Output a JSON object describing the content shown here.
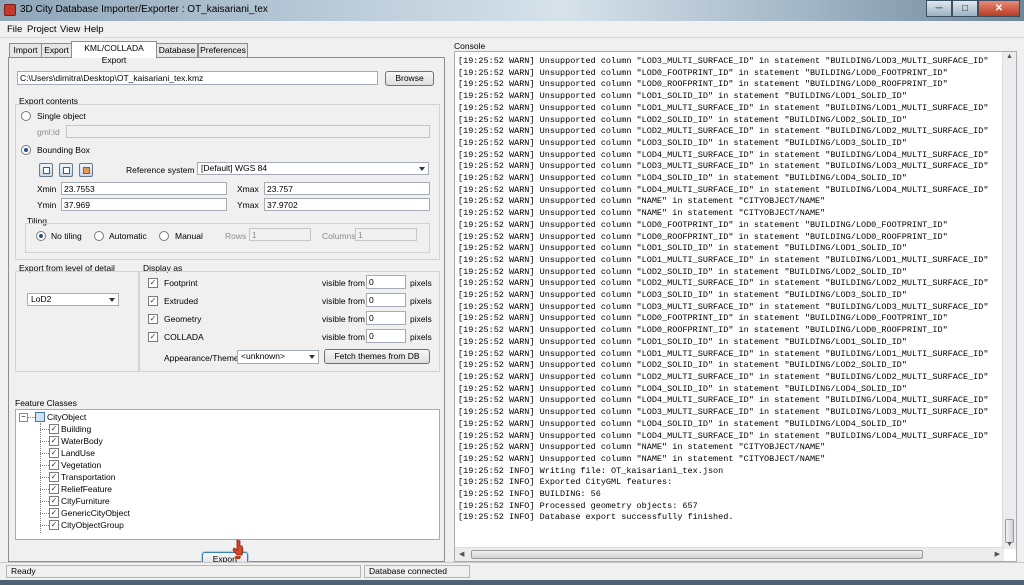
{
  "window": {
    "title": "3D City Database Importer/Exporter : OT_kaisariani_tex"
  },
  "window_controls": {
    "minimize": "─",
    "maximize": "□",
    "close": "✕"
  },
  "menu": {
    "file": "File",
    "project": "Project",
    "view": "View",
    "help": "Help"
  },
  "tabs": {
    "import": "Import",
    "export": "Export",
    "kml": "KML/COLLADA Export",
    "database": "Database",
    "preferences": "Preferences"
  },
  "file": {
    "path": "C:\\Users\\dimitra\\Desktop\\OT_kaisariani_tex.kmz",
    "browse": "Browse"
  },
  "export_contents": {
    "label": "Export contents",
    "single_object": "Single object",
    "gmlid_label": "gml:id",
    "bounding_box": "Bounding Box",
    "mode": "Bounding Box",
    "ref_system_label": "Reference system",
    "ref_system_value": "[Default] WGS 84",
    "xmin_label": "Xmin",
    "xmin": "23.7553",
    "xmax_label": "Xmax",
    "xmax": "23.757",
    "ymin_label": "Ymin",
    "ymin": "37.969",
    "ymax_label": "Ymax",
    "ymax": "37.9702"
  },
  "tiling": {
    "label": "Tiling",
    "no_tiling": "No tiling",
    "automatic": "Automatic",
    "manual": "Manual",
    "selected": "No tiling",
    "rows_label": "Rows",
    "rows": "1",
    "columns_label": "Columns",
    "columns": "1"
  },
  "lod": {
    "label": "Export from level of detail",
    "value": "LoD2"
  },
  "display_as": {
    "label": "Display as",
    "visible_from": "visible from",
    "pixels": "pixels",
    "rows": [
      {
        "name": "Footprint",
        "checked": true,
        "value": "0"
      },
      {
        "name": "Extruded",
        "checked": true,
        "value": "0"
      },
      {
        "name": "Geometry",
        "checked": true,
        "value": "0"
      },
      {
        "name": "COLLADA",
        "checked": true,
        "value": "0"
      }
    ],
    "appearance_label": "Appearance/Theme",
    "appearance_value": "<unknown>",
    "fetch_button": "Fetch themes from DB"
  },
  "feature_classes": {
    "label": "Feature Classes",
    "root": "CityObject",
    "items": [
      "Building",
      "WaterBody",
      "LandUse",
      "Vegetation",
      "Transportation",
      "ReliefFeature",
      "CityFurniture",
      "GenericCityObject",
      "CityObjectGroup"
    ]
  },
  "export_button": "Export",
  "console": {
    "label": "Console",
    "lines": [
      "[19:25:52 WARN] Unsupported column \"LOD3_MULTI_SURFACE_ID\" in statement \"BUILDING/LOD3_MULTI_SURFACE_ID\"",
      "[19:25:52 WARN] Unsupported column \"LOD0_FOOTPRINT_ID\" in statement \"BUILDING/LOD0_FOOTPRINT_ID\"",
      "[19:25:52 WARN] Unsupported column \"LOD0_ROOFPRINT_ID\" in statement \"BUILDING/LOD0_ROOFPRINT_ID\"",
      "[19:25:52 WARN] Unsupported column \"LOD1_SOLID_ID\" in statement \"BUILDING/LOD1_SOLID_ID\"",
      "[19:25:52 WARN] Unsupported column \"LOD1_MULTI_SURFACE_ID\" in statement \"BUILDING/LOD1_MULTI_SURFACE_ID\"",
      "[19:25:52 WARN] Unsupported column \"LOD2_SOLID_ID\" in statement \"BUILDING/LOD2_SOLID_ID\"",
      "[19:25:52 WARN] Unsupported column \"LOD2_MULTI_SURFACE_ID\" in statement \"BUILDING/LOD2_MULTI_SURFACE_ID\"",
      "[19:25:52 WARN] Unsupported column \"LOD3_SOLID_ID\" in statement \"BUILDING/LOD3_SOLID_ID\"",
      "[19:25:52 WARN] Unsupported column \"LOD4_MULTI_SURFACE_ID\" in statement \"BUILDING/LOD4_MULTI_SURFACE_ID\"",
      "[19:25:52 WARN] Unsupported column \"LOD3_MULTI_SURFACE_ID\" in statement \"BUILDING/LOD3_MULTI_SURFACE_ID\"",
      "[19:25:52 WARN] Unsupported column \"LOD4_SOLID_ID\" in statement \"BUILDING/LOD4_SOLID_ID\"",
      "[19:25:52 WARN] Unsupported column \"LOD4_MULTI_SURFACE_ID\" in statement \"BUILDING/LOD4_MULTI_SURFACE_ID\"",
      "[19:25:52 WARN] Unsupported column \"NAME\" in statement \"CITYOBJECT/NAME\"",
      "[19:25:52 WARN] Unsupported column \"NAME\" in statement \"CITYOBJECT/NAME\"",
      "[19:25:52 WARN] Unsupported column \"LOD0_FOOTPRINT_ID\" in statement \"BUILDING/LOD0_FOOTPRINT_ID\"",
      "[19:25:52 WARN] Unsupported column \"LOD0_ROOFPRINT_ID\" in statement \"BUILDING/LOD0_ROOFPRINT_ID\"",
      "[19:25:52 WARN] Unsupported column \"LOD1_SOLID_ID\" in statement \"BUILDING/LOD1_SOLID_ID\"",
      "[19:25:52 WARN] Unsupported column \"LOD1_MULTI_SURFACE_ID\" in statement \"BUILDING/LOD1_MULTI_SURFACE_ID\"",
      "[19:25:52 WARN] Unsupported column \"LOD2_SOLID_ID\" in statement \"BUILDING/LOD2_SOLID_ID\"",
      "[19:25:52 WARN] Unsupported column \"LOD2_MULTI_SURFACE_ID\" in statement \"BUILDING/LOD2_MULTI_SURFACE_ID\"",
      "[19:25:52 WARN] Unsupported column \"LOD3_SOLID_ID\" in statement \"BUILDING/LOD3_SOLID_ID\"",
      "[19:25:52 WARN] Unsupported column \"LOD3_MULTI_SURFACE_ID\" in statement \"BUILDING/LOD3_MULTI_SURFACE_ID\"",
      "[19:25:52 WARN] Unsupported column \"LOD0_FOOTPRINT_ID\" in statement \"BUILDING/LOD0_FOOTPRINT_ID\"",
      "[19:25:52 WARN] Unsupported column \"LOD0_ROOFPRINT_ID\" in statement \"BUILDING/LOD0_ROOFPRINT_ID\"",
      "[19:25:52 WARN] Unsupported column \"LOD1_SOLID_ID\" in statement \"BUILDING/LOD1_SOLID_ID\"",
      "[19:25:52 WARN] Unsupported column \"LOD1_MULTI_SURFACE_ID\" in statement \"BUILDING/LOD1_MULTI_SURFACE_ID\"",
      "[19:25:52 WARN] Unsupported column \"LOD2_SOLID_ID\" in statement \"BUILDING/LOD2_SOLID_ID\"",
      "[19:25:52 WARN] Unsupported column \"LOD2_MULTI_SURFACE_ID\" in statement \"BUILDING/LOD2_MULTI_SURFACE_ID\"",
      "[19:25:52 WARN] Unsupported column \"LOD4_SOLID_ID\" in statement \"BUILDING/LOD4_SOLID_ID\"",
      "[19:25:52 WARN] Unsupported column \"LOD4_MULTI_SURFACE_ID\" in statement \"BUILDING/LOD4_MULTI_SURFACE_ID\"",
      "[19:25:52 WARN] Unsupported column \"LOD3_MULTI_SURFACE_ID\" in statement \"BUILDING/LOD3_MULTI_SURFACE_ID\"",
      "[19:25:52 WARN] Unsupported column \"LOD4_SOLID_ID\" in statement \"BUILDING/LOD4_SOLID_ID\"",
      "[19:25:52 WARN] Unsupported column \"LOD4_MULTI_SURFACE_ID\" in statement \"BUILDING/LOD4_MULTI_SURFACE_ID\"",
      "[19:25:52 WARN] Unsupported column \"NAME\" in statement \"CITYOBJECT/NAME\"",
      "[19:25:52 WARN] Unsupported column \"NAME\" in statement \"CITYOBJECT/NAME\"",
      "[19:25:52 INFO] Writing file: OT_kaisariani_tex.json",
      "[19:25:52 INFO] Exported CityGML features:",
      "[19:25:52 INFO] BUILDING: 56",
      "[19:25:52 INFO] Processed geometry objects: 657",
      "[19:25:52 INFO] Database export successfully finished."
    ]
  },
  "status": {
    "left": "Ready",
    "right": "Database connected"
  }
}
